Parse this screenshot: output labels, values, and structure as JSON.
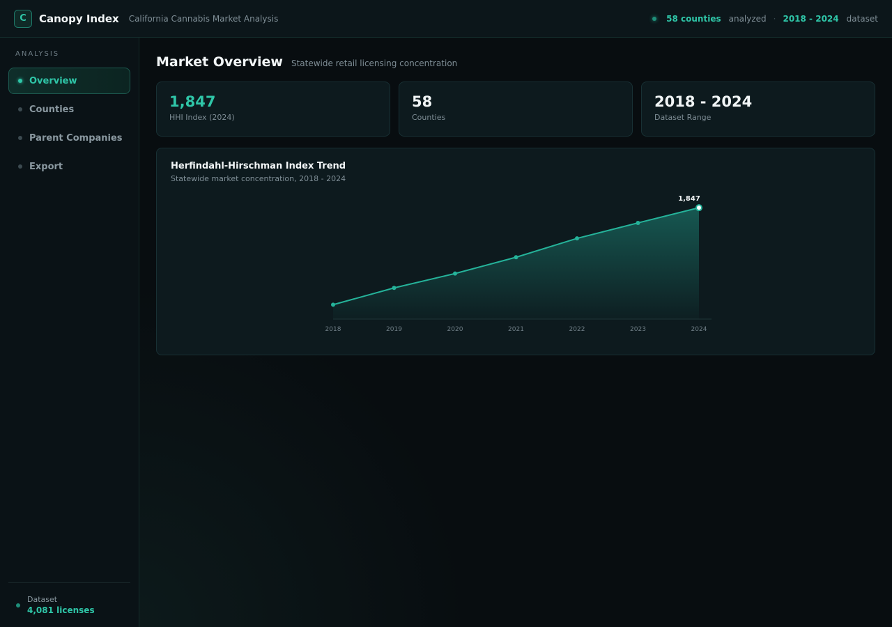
{
  "header": {
    "logo_letter": "C",
    "title": "Canopy Index",
    "subtitle": "California Cannabis Market Analysis",
    "counties_highlight": "58 counties",
    "counties_suffix": "analyzed",
    "separator": "·",
    "dataset_highlight": "2018 - 2024",
    "dataset_suffix": "dataset"
  },
  "sidebar": {
    "section_label": "ANALYSIS",
    "items": [
      {
        "label": "Overview",
        "active": true
      },
      {
        "label": "Counties",
        "active": false
      },
      {
        "label": "Parent Companies",
        "active": false
      },
      {
        "label": "Export",
        "active": false
      }
    ],
    "footer": {
      "label": "Dataset",
      "value": "4,081 licenses"
    }
  },
  "main": {
    "title": "Market Overview",
    "subtitle": "Statewide retail licensing concentration",
    "stats": [
      {
        "value": "1,847",
        "label": "HHI Index (2024)"
      },
      {
        "value": "58",
        "label": "Counties"
      },
      {
        "value": "2018 - 2024",
        "label": "Dataset Range"
      }
    ],
    "chart_card": {
      "title": "Herfindahl-Hirschman Index Trend",
      "subtitle": "Statewide market concentration, 2018 - 2024"
    }
  },
  "colors": {
    "accent": "#2fc6a8",
    "background": "#080d10",
    "card": "#0d1a1e"
  },
  "chart_data": {
    "type": "area",
    "x": [
      "2018",
      "2019",
      "2020",
      "2021",
      "2022",
      "2023",
      "2024"
    ],
    "series": [
      {
        "values": [
          1240,
          1345,
          1435,
          1537,
          1655,
          1752,
          1847
        ]
      }
    ],
    "title": "Herfindahl-Hirschman Index Trend",
    "subtitle": "Statewide market concentration, 2018 - 2024",
    "xlabel": "",
    "ylabel": "",
    "ylim": [
      1150,
      1900
    ],
    "grid": false,
    "annotations": [
      {
        "x": "2024",
        "label": "1,847"
      }
    ]
  }
}
